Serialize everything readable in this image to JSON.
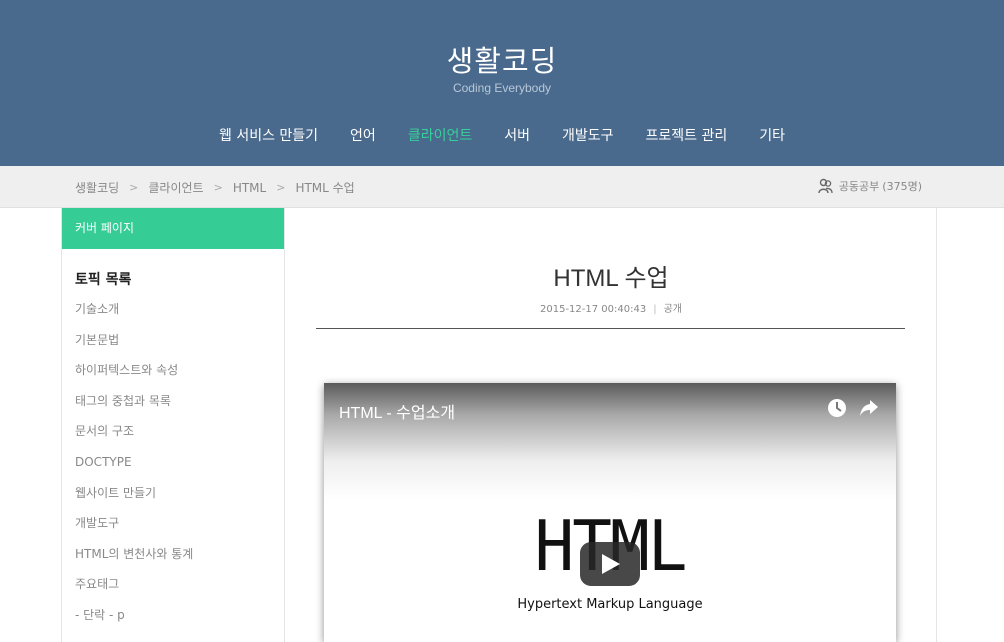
{
  "site": {
    "title": "생활코딩",
    "subtitle": "Coding Everybody"
  },
  "nav": {
    "items": [
      {
        "label": "웹 서비스 만들기",
        "active": false
      },
      {
        "label": "언어",
        "active": false
      },
      {
        "label": "클라이언트",
        "active": true
      },
      {
        "label": "서버",
        "active": false
      },
      {
        "label": "개발도구",
        "active": false
      },
      {
        "label": "프로젝트 관리",
        "active": false
      },
      {
        "label": "기타",
        "active": false
      }
    ],
    "active_color": "#36d19a"
  },
  "breadcrumb": {
    "items": [
      "생활코딩",
      "클라이언트",
      "HTML",
      "HTML 수업"
    ],
    "separator": ">"
  },
  "study_group": {
    "label": "공동공부",
    "count": "(375명)",
    "icon": "users-icon"
  },
  "sidebar": {
    "cover_label": "커버 페이지",
    "topic_title": "토픽 목록",
    "topics": [
      "기술소개",
      "기본문법",
      "하이퍼텍스트와 속성",
      "태그의 중첩과 목록",
      "문서의 구조",
      "DOCTYPE",
      "웹사이트 만들기",
      "개발도구",
      "HTML의 변천사와 통계",
      "주요태그",
      "- 단락 - p"
    ]
  },
  "post": {
    "title": "HTML 수업",
    "date": "2015-12-17 00:40:43",
    "visibility": "공개"
  },
  "video": {
    "title": "HTML - 수업소개",
    "logo_text": "HTML",
    "logo_caption": "Hypertext Markup Language",
    "icons": [
      "clock-icon",
      "share-icon",
      "play-icon"
    ]
  },
  "colors": {
    "header_bg": "#4a6a8d",
    "accent": "#36cc96",
    "crumb_bg": "#efefef"
  }
}
